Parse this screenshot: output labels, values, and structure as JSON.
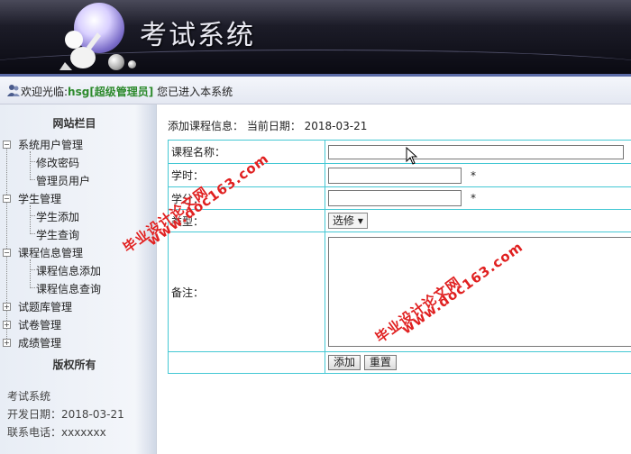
{
  "banner": {
    "title": "考试系统"
  },
  "welcome": {
    "prefix": "欢迎光临:",
    "user": "hsg[超级管理员]",
    "suffix": " 您已进入本系统"
  },
  "sidebar": {
    "heading": "网站栏目",
    "items": [
      {
        "label": "系统用户管理",
        "expander": "−"
      },
      {
        "label": "修改密码"
      },
      {
        "label": "管理员用户"
      },
      {
        "label": "学生管理",
        "expander": "−"
      },
      {
        "label": "学生添加"
      },
      {
        "label": "学生查询"
      },
      {
        "label": "课程信息管理",
        "expander": "−"
      },
      {
        "label": "课程信息添加"
      },
      {
        "label": "课程信息查询"
      },
      {
        "label": "试题库管理",
        "expander": "+"
      },
      {
        "label": "试卷管理",
        "expander": "+"
      },
      {
        "label": "成绩管理",
        "expander": "+"
      }
    ],
    "copyright": "版权所有",
    "info": [
      "考试系统",
      "开发日期：2018-03-21",
      "联系电话：xxxxxxx"
    ]
  },
  "main": {
    "header": "添加课程信息：   当前日期：  2018-03-21",
    "fields": {
      "name_label": "课程名称：",
      "hours_label": "学时：",
      "credit_label": "学分：",
      "type_label": "类型：",
      "note_label": "备注：",
      "required_mark": "*",
      "type_value": "选修 ▾"
    },
    "buttons": {
      "add": "添加",
      "reset": "重置"
    }
  },
  "watermarks": [
    "毕业设计论文网",
    "www.doc163.com"
  ]
}
